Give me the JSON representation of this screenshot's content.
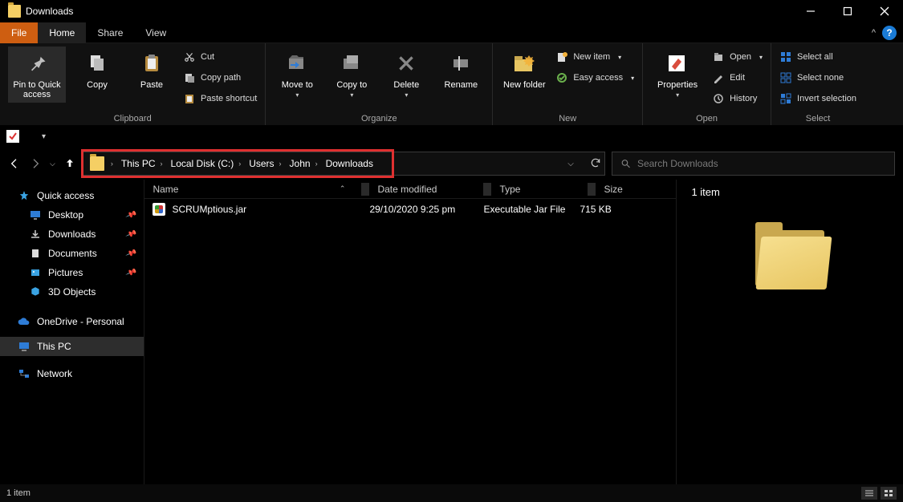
{
  "window": {
    "title": "Downloads"
  },
  "tabs": {
    "file": "File",
    "home": "Home",
    "share": "Share",
    "view": "View",
    "help": "?",
    "caret": "^"
  },
  "ribbon": {
    "clipboard": {
      "label": "Clipboard",
      "pin": "Pin to Quick access",
      "copy": "Copy",
      "paste": "Paste",
      "cut": "Cut",
      "copy_path": "Copy path",
      "paste_shortcut": "Paste shortcut"
    },
    "organize": {
      "label": "Organize",
      "move_to": "Move to",
      "copy_to": "Copy to",
      "delete": "Delete",
      "rename": "Rename",
      "dd": "▾"
    },
    "new_": {
      "label": "New",
      "new_folder": "New folder",
      "new_item": "New item",
      "easy_access": "Easy access",
      "dd": "▾"
    },
    "open": {
      "label": "Open",
      "properties": "Properties",
      "open": "Open",
      "edit": "Edit",
      "history": "History",
      "dd": "▾"
    },
    "select": {
      "label": "Select",
      "select_all": "Select all",
      "select_none": "Select none",
      "invert": "Invert selection"
    }
  },
  "breadcrumb": [
    "This PC",
    "Local Disk (C:)",
    "Users",
    "John",
    "Downloads"
  ],
  "search": {
    "placeholder": "Search Downloads"
  },
  "columns": {
    "name": "Name",
    "date": "Date modified",
    "type": "Type",
    "size": "Size"
  },
  "files": [
    {
      "name": "SCRUMptious.jar",
      "date": "29/10/2020 9:25 pm",
      "type": "Executable Jar File",
      "size": "715 KB"
    }
  ],
  "nav": {
    "quick_access": "Quick access",
    "items_qa": [
      "Desktop",
      "Downloads",
      "Documents",
      "Pictures",
      "3D Objects"
    ],
    "onedrive": "OneDrive - Personal",
    "this_pc": "This PC",
    "network": "Network"
  },
  "preview": {
    "count": "1 item"
  },
  "status": {
    "left": "1 item"
  }
}
